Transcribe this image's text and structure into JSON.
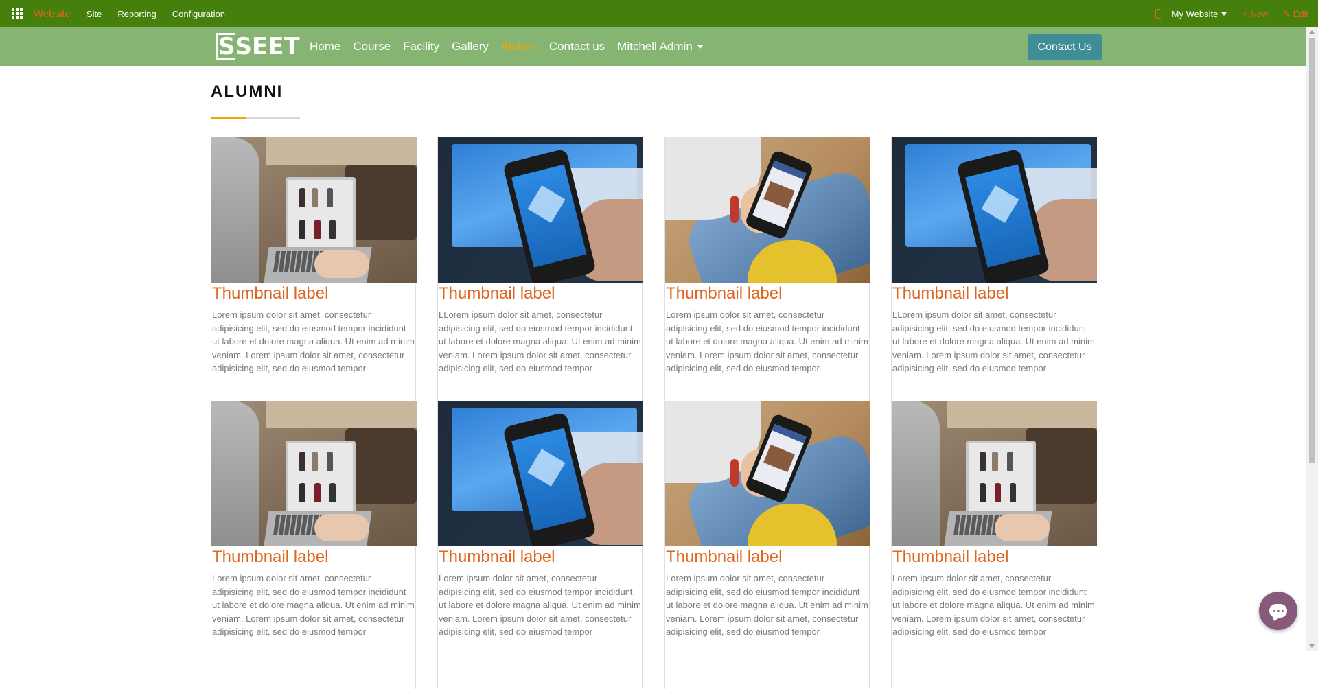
{
  "adminbar": {
    "brand": "Website",
    "menu": [
      "Site",
      "Reporting",
      "Configuration"
    ],
    "website_selector": "My Website",
    "new_label": "New",
    "edit_label": "Edit",
    "icons": [
      "apps-icon",
      "mobile-icon",
      "plus-icon",
      "pencil-icon"
    ]
  },
  "header": {
    "logo_letter": "S",
    "logo_text": "SEET",
    "nav": [
      "Home",
      "Course",
      "Facility",
      "Gallery",
      "Alumni",
      "Contact us"
    ],
    "active_nav": "Alumni",
    "user": "Mitchell Admin",
    "cta": "Contact Us"
  },
  "page": {
    "heading": "ALUMNI"
  },
  "cards": [
    {
      "image": "laptop-shopping",
      "title": "Thumbnail label",
      "text": "Lorem ipsum dolor sit amet, consectetur adipisicing elit, sed do eiusmod tempor incididunt ut labore et dolore magna aliqua. Ut enim ad minim veniam. Lorem ipsum dolor sit amet, consectetur adipisicing elit, sed do eiusmod tempor"
    },
    {
      "image": "dropbox-phone",
      "title": "Thumbnail label",
      "text": "LLorem ipsum dolor sit amet, consectetur adipisicing elit, sed do eiusmod tempor incididunt ut labore et dolore magna aliqua. Ut enim ad minim veniam. Lorem ipsum dolor sit amet, consectetur adipisicing elit, sed do eiusmod tempor"
    },
    {
      "image": "facebook-phone",
      "title": "Thumbnail label",
      "text": "Lorem ipsum dolor sit amet, consectetur adipisicing elit, sed do eiusmod tempor incididunt ut labore et dolore magna aliqua. Ut enim ad minim veniam. Lorem ipsum dolor sit amet, consectetur adipisicing elit, sed do eiusmod tempor"
    },
    {
      "image": "dropbox-phone",
      "title": "Thumbnail label",
      "text": "LLorem ipsum dolor sit amet, consectetur adipisicing elit, sed do eiusmod tempor incididunt ut labore et dolore magna aliqua. Ut enim ad minim veniam. Lorem ipsum dolor sit amet, consectetur adipisicing elit, sed do eiusmod tempor"
    },
    {
      "image": "laptop-shopping",
      "title": "Thumbnail label",
      "text": "Lorem ipsum dolor sit amet, consectetur adipisicing elit, sed do eiusmod tempor incididunt ut labore et dolore magna aliqua. Ut enim ad minim veniam. Lorem ipsum dolor sit amet, consectetur adipisicing elit, sed do eiusmod tempor"
    },
    {
      "image": "dropbox-phone",
      "title": "Thumbnail label",
      "text": "Lorem ipsum dolor sit amet, consectetur adipisicing elit, sed do eiusmod tempor incididunt ut labore et dolore magna aliqua. Ut enim ad minim veniam. Lorem ipsum dolor sit amet, consectetur adipisicing elit, sed do eiusmod tempor"
    },
    {
      "image": "facebook-phone",
      "title": "Thumbnail label",
      "text": "Lorem ipsum dolor sit amet, consectetur adipisicing elit, sed do eiusmod tempor incididunt ut labore et dolore magna aliqua. Ut enim ad minim veniam. Lorem ipsum dolor sit amet, consectetur adipisicing elit, sed do eiusmod tempor"
    },
    {
      "image": "laptop-shopping",
      "title": "Thumbnail label",
      "text": "Lorem ipsum dolor sit amet, consectetur adipisicing elit, sed do eiusmod tempor incididunt ut labore et dolore magna aliqua. Ut enim ad minim veniam. Lorem ipsum dolor sit amet, consectetur adipisicing elit, sed do eiusmod tempor"
    }
  ],
  "colors": {
    "adminbar": "#44800b",
    "header": "#86b573",
    "accent": "#e0651f",
    "active_nav": "#f0a500",
    "cta": "#3f8d97",
    "chat": "#875a7b"
  },
  "chat_icon": "chat-icon"
}
